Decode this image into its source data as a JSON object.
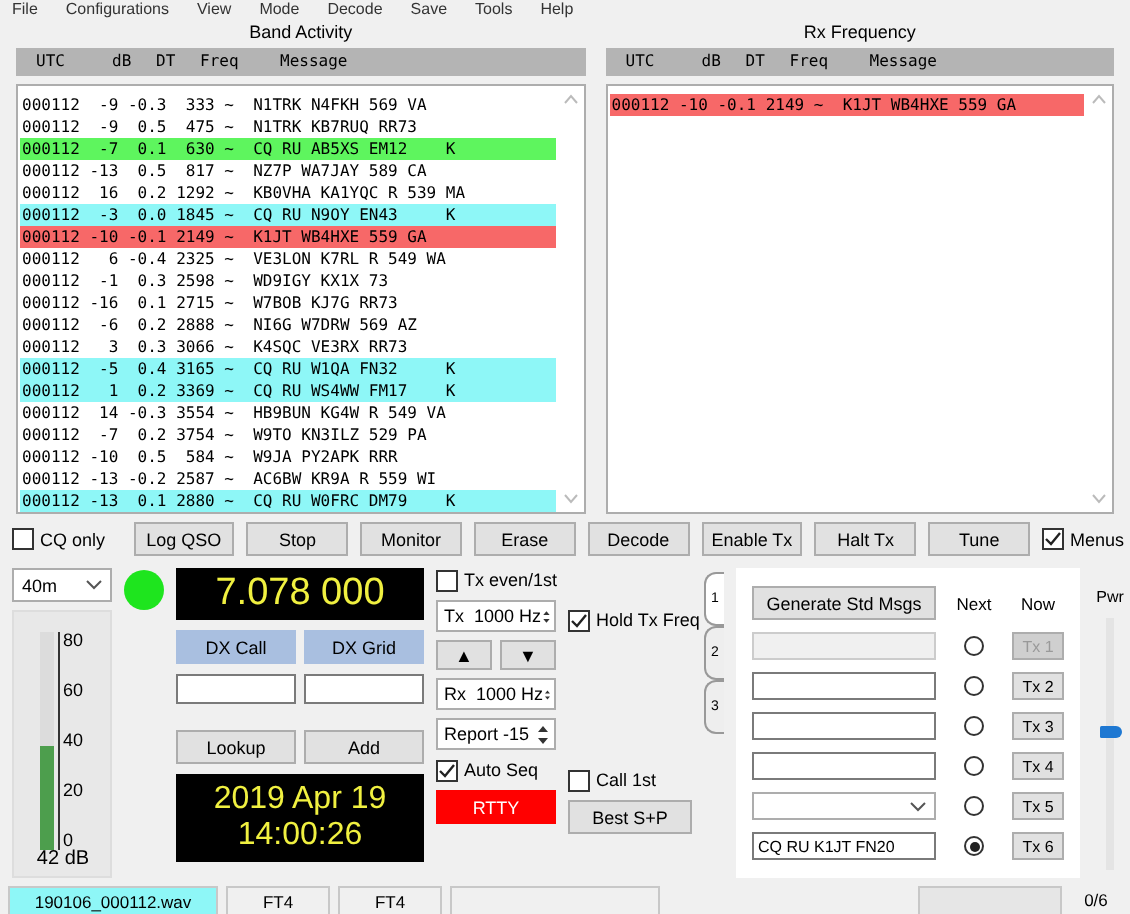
{
  "menu": [
    "File",
    "Configurations",
    "View",
    "Mode",
    "Decode",
    "Save",
    "Tools",
    "Help"
  ],
  "band_activity": {
    "title": "Band Activity",
    "columns": [
      "UTC",
      "dB",
      "DT",
      "Freq",
      "Message"
    ],
    "rows": [
      {
        "text": "000112  -9 -0.3  333 ~  N1TRK N4FKH 569 VA"
      },
      {
        "text": "000112  -9  0.5  475 ~  N1TRK KB7RUQ RR73"
      },
      {
        "text": "000112  -7  0.1  630 ~  CQ RU AB5XS EM12    K",
        "color": "#5ef55e"
      },
      {
        "text": "000112 -13  0.5  817 ~  NZ7P WA7JAY 589 CA"
      },
      {
        "text": "000112  16  0.2 1292 ~  KB0VHA KA1YQC R 539 MA"
      },
      {
        "text": "000112  -3  0.0 1845 ~  CQ RU N9OY EN43     K",
        "color": "#8ef7f7"
      },
      {
        "text": "000112 -10 -0.1 2149 ~  K1JT WB4HXE 559 GA",
        "color": "#f76868"
      },
      {
        "text": "000112   6 -0.4 2325 ~  VE3LON K7RL R 549 WA"
      },
      {
        "text": "000112  -1  0.3 2598 ~  WD9IGY KX1X 73"
      },
      {
        "text": "000112 -16  0.1 2715 ~  W7BOB KJ7G RR73"
      },
      {
        "text": "000112  -6  0.2 2888 ~  NI6G W7DRW 569 AZ"
      },
      {
        "text": "000112   3  0.3 3066 ~  K4SQC VE3RX RR73"
      },
      {
        "text": "000112  -5  0.4 3165 ~  CQ RU W1QA FN32     K",
        "color": "#8ef7f7"
      },
      {
        "text": "000112   1  0.2 3369 ~  CQ RU WS4WW FM17    K",
        "color": "#8ef7f7"
      },
      {
        "text": "000112  14 -0.3 3554 ~  HB9BUN KG4W R 549 VA"
      },
      {
        "text": "000112  -7  0.2 3754 ~  W9TO KN3ILZ 529 PA"
      },
      {
        "text": "000112 -10  0.5  584 ~  W9JA PY2APK RRR"
      },
      {
        "text": "000112 -13 -0.2 2587 ~  AC6BW KR9A R 559 WI"
      },
      {
        "text": "000112 -13  0.1 2880 ~  CQ RU W0FRC DM79    K",
        "color": "#8ef7f7"
      }
    ]
  },
  "rx_frequency": {
    "title": "Rx Frequency",
    "columns": [
      "UTC",
      "dB",
      "DT",
      "Freq",
      "Message"
    ],
    "rows": [
      {
        "text": "000112 -10 -0.1 2149 ~  K1JT WB4HXE 559 GA",
        "color": "#f76868"
      }
    ]
  },
  "controls": [
    {
      "kind": "checkbox",
      "label": "CQ only",
      "checked": false
    },
    {
      "kind": "button",
      "label": "Log QSO"
    },
    {
      "kind": "button",
      "label": "Stop"
    },
    {
      "kind": "button",
      "label": "Monitor"
    },
    {
      "kind": "button",
      "label": "Erase"
    },
    {
      "kind": "button",
      "label": "Decode"
    },
    {
      "kind": "button",
      "label": "Enable Tx"
    },
    {
      "kind": "button",
      "label": "Halt Tx"
    },
    {
      "kind": "button",
      "label": "Tune"
    },
    {
      "kind": "checkbox",
      "label": "Menus",
      "checked": true
    }
  ],
  "band": "40m",
  "signal": {
    "scale": [
      "80",
      "60",
      "40",
      "20",
      "0"
    ],
    "level": 0.48,
    "reading": "42 dB"
  },
  "frequency": "7.078 000",
  "dx_call": {
    "label": "DX Call"
  },
  "dx_grid": {
    "label": "DX Grid"
  },
  "lookup": "Lookup",
  "add": "Add",
  "date": "2019 Apr 19",
  "time": "14:00:26",
  "tx_even": {
    "label": "Tx even/1st",
    "checked": false
  },
  "tx_freq": "Tx  1000 Hz",
  "hold_tx": {
    "label": "Hold Tx Freq",
    "checked": true
  },
  "arrows": [
    "▲",
    "▼"
  ],
  "rx_freq": "Rx  1000 Hz",
  "report": "Report -15",
  "auto_seq": {
    "label": "Auto Seq",
    "checked": true
  },
  "call_1st": {
    "label": "Call 1st",
    "checked": false
  },
  "rtty": "RTTY",
  "best_sp": "Best S+P",
  "msg_tabs": [
    {
      "label": "1",
      "selected": true
    },
    {
      "label": "2",
      "selected": false
    },
    {
      "label": "3",
      "selected": false
    }
  ],
  "generate": "Generate Std Msgs",
  "next_label": "Next",
  "now_label": "Now",
  "messages": [
    {
      "kind": "text",
      "disabled": true,
      "selected": false,
      "button": "Tx 1"
    },
    {
      "kind": "text",
      "disabled": false,
      "selected": false,
      "button": "Tx 2"
    },
    {
      "kind": "text",
      "disabled": false,
      "selected": false,
      "button": "Tx 3"
    },
    {
      "kind": "text",
      "disabled": false,
      "selected": false,
      "button": "Tx 4"
    },
    {
      "kind": "combo",
      "disabled": false,
      "selected": false,
      "button": "Tx 5"
    },
    {
      "kind": "text",
      "value": "CQ RU K1JT FN20",
      "disabled": false,
      "selected": true,
      "button": "Tx 6"
    }
  ],
  "power": {
    "label": "Pwr",
    "level": 0.55
  },
  "status_bar": [
    {
      "text": "190106_000112.wav",
      "highlight": true
    },
    {
      "text": "FT4",
      "highlight": false
    },
    {
      "text": "FT4",
      "highlight": false
    }
  ],
  "progress": {
    "level": 0,
    "reading": "0/6"
  }
}
